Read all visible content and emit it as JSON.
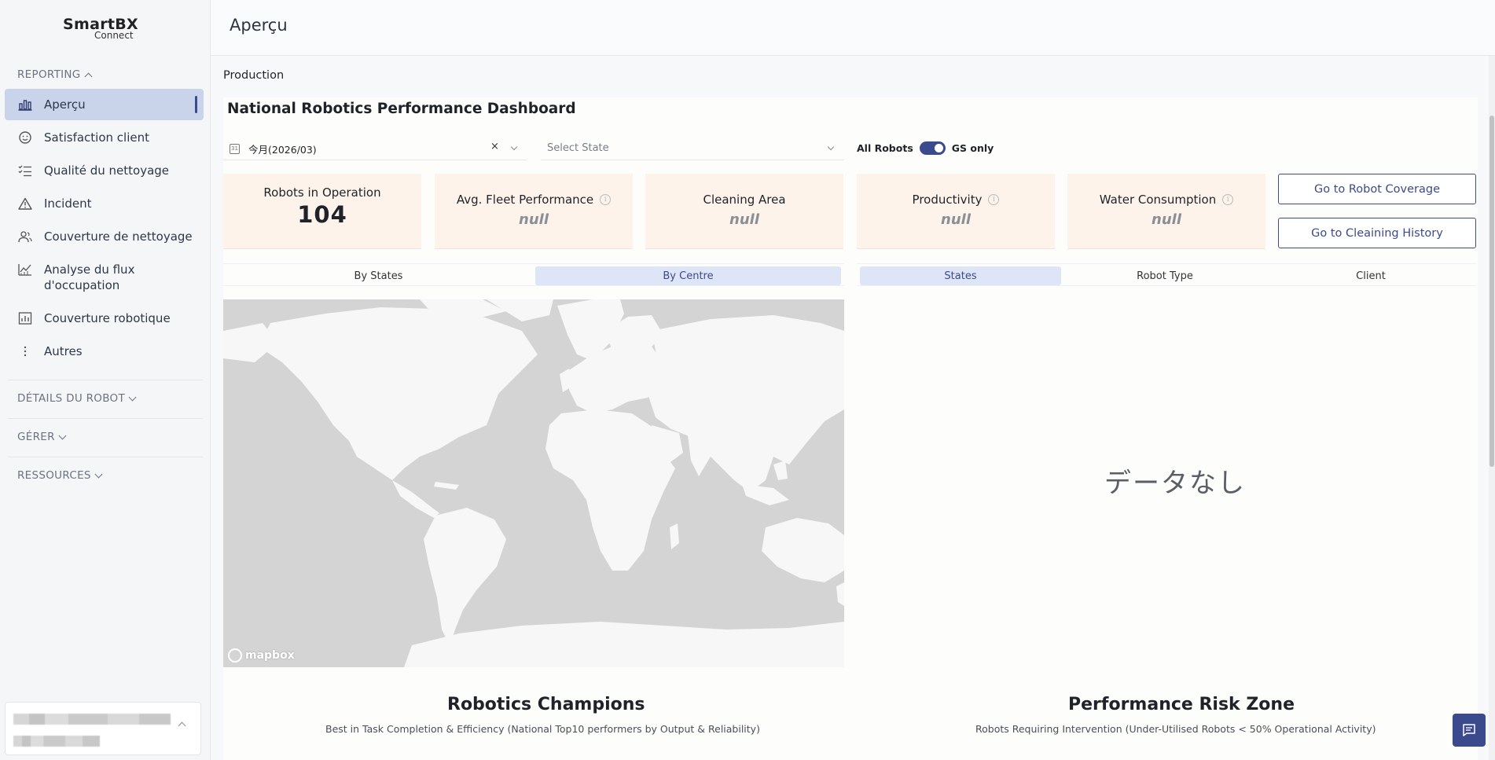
{
  "brand": {
    "name": "SmartBX",
    "sub": "Connect"
  },
  "sidebar": {
    "reporting_label": "REPORTING",
    "items": [
      {
        "label": "Aperçu",
        "icon": "bar-chart-icon"
      },
      {
        "label": "Satisfaction client",
        "icon": "smiley-icon"
      },
      {
        "label": "Qualité du nettoyage",
        "icon": "checklist-icon"
      },
      {
        "label": "Incident",
        "icon": "warning-icon"
      },
      {
        "label": "Couverture de nettoyage",
        "icon": "users-icon"
      },
      {
        "label": "Analyse du flux d'occupation",
        "icon": "line-chart-icon"
      },
      {
        "label": "Couverture robotique",
        "icon": "robot-chart-icon"
      },
      {
        "label": "Autres",
        "icon": "more-vertical-icon"
      }
    ],
    "robot_details_label": "DÉTAILS DU ROBOT",
    "manage_label": "GÉRER",
    "resources_label": "RESSOURCES"
  },
  "header": {
    "title": "Aperçu"
  },
  "main": {
    "section_label": "Production",
    "dashboard_title": "National Robotics Performance Dashboard",
    "filters": {
      "date_value": "今月(2026/03)",
      "clear_symbol": "×",
      "state_placeholder": "Select State",
      "toggle_left": "All Robots",
      "toggle_right": "GS only",
      "toggle_on": true
    },
    "kpis": [
      {
        "label": "Robots in Operation",
        "value": "104",
        "has_info": false
      },
      {
        "label": "Avg. Fleet Performance",
        "value": "null",
        "has_info": true
      },
      {
        "label": "Cleaning Area",
        "value": "null",
        "has_info": false
      },
      {
        "label": "Productivity",
        "value": "null",
        "has_info": true
      },
      {
        "label": "Water Consumption",
        "value": "null",
        "has_info": true
      }
    ],
    "buttons": {
      "robot_coverage": "Go to Robot Coverage",
      "cleaning_history": "Go to Cleaining History"
    },
    "map_tabs": [
      "By States",
      "By Centre"
    ],
    "map_tab_active": 1,
    "chart_tabs": [
      "States",
      "Robot Type",
      "Client"
    ],
    "chart_tab_active": 0,
    "map_attribution": "mapbox",
    "no_data": "データなし",
    "champions": {
      "title": "Robotics Champions",
      "subtitle": "Best in Task Completion & Efficiency (National Top10 performers by Output & Reliability)"
    },
    "risk": {
      "title": "Performance Risk Zone",
      "subtitle": "Robots Requiring Intervention (Under-Utilised Robots < 50% Operational Activity)"
    }
  },
  "colors": {
    "accent": "#3b4a8c",
    "active_nav": "#c9d3ea",
    "kpi_bg": "#fdf3ea",
    "map_land": "#f7f7f7",
    "map_water": "#d4d4d4"
  }
}
